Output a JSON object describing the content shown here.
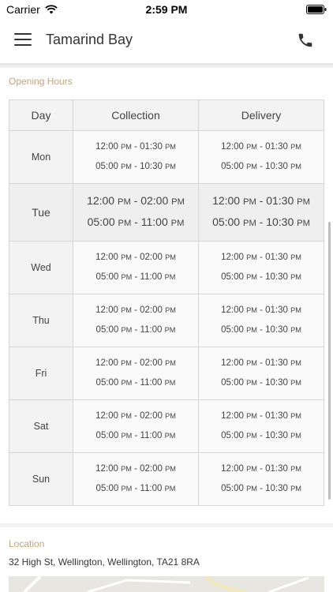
{
  "status": {
    "carrier": "Carrier",
    "time": "2:59 PM"
  },
  "header": {
    "title": "Tamarind Bay"
  },
  "opening_hours": {
    "title": "Opening Hours",
    "columns": [
      "Day",
      "Collection",
      "Delivery"
    ],
    "rows": [
      {
        "day": "Mon",
        "collection": [
          "12:00 PM - 01:30 PM",
          "05:00 PM - 10:30 PM"
        ],
        "delivery": [
          "12:00 PM - 01:30 PM",
          "05:00 PM - 10:30 PM"
        ]
      },
      {
        "day": "Tue",
        "collection": [
          "12:00 PM - 02:00 PM",
          "05:00 PM - 11:00 PM"
        ],
        "delivery": [
          "12:00 PM - 01:30 PM",
          "05:00 PM - 10:30 PM"
        ]
      },
      {
        "day": "Wed",
        "collection": [
          "12:00 PM - 02:00 PM",
          "05:00 PM - 11:00 PM"
        ],
        "delivery": [
          "12:00 PM - 01:30 PM",
          "05:00 PM - 10:30 PM"
        ]
      },
      {
        "day": "Thu",
        "collection": [
          "12:00 PM - 02:00 PM",
          "05:00 PM - 11:00 PM"
        ],
        "delivery": [
          "12:00 PM - 01:30 PM",
          "05:00 PM - 10:30 PM"
        ]
      },
      {
        "day": "Fri",
        "collection": [
          "12:00 PM - 02:00 PM",
          "05:00 PM - 11:00 PM"
        ],
        "delivery": [
          "12:00 PM - 01:30 PM",
          "05:00 PM - 10:30 PM"
        ]
      },
      {
        "day": "Sat",
        "collection": [
          "12:00 PM - 02:00 PM",
          "05:00 PM - 11:00 PM"
        ],
        "delivery": [
          "12:00 PM - 01:30 PM",
          "05:00 PM - 10:30 PM"
        ]
      },
      {
        "day": "Sun",
        "collection": [
          "12:00 PM - 02:00 PM",
          "05:00 PM - 11:00 PM"
        ],
        "delivery": [
          "12:00 PM - 01:30 PM",
          "05:00 PM - 10:30 PM"
        ]
      }
    ],
    "highlighted_day": "Tue"
  },
  "location": {
    "title": "Location",
    "address": "32 High St, Wellington, Wellington, TA21 8RA"
  },
  "colors": {
    "accent": "#bfa57e",
    "border": "#d6d6d6",
    "header_bg": "#ffffff"
  },
  "icons": {
    "menu": "hamburger-icon",
    "phone": "phone-icon",
    "wifi": "wifi-icon",
    "battery": "battery-icon"
  }
}
